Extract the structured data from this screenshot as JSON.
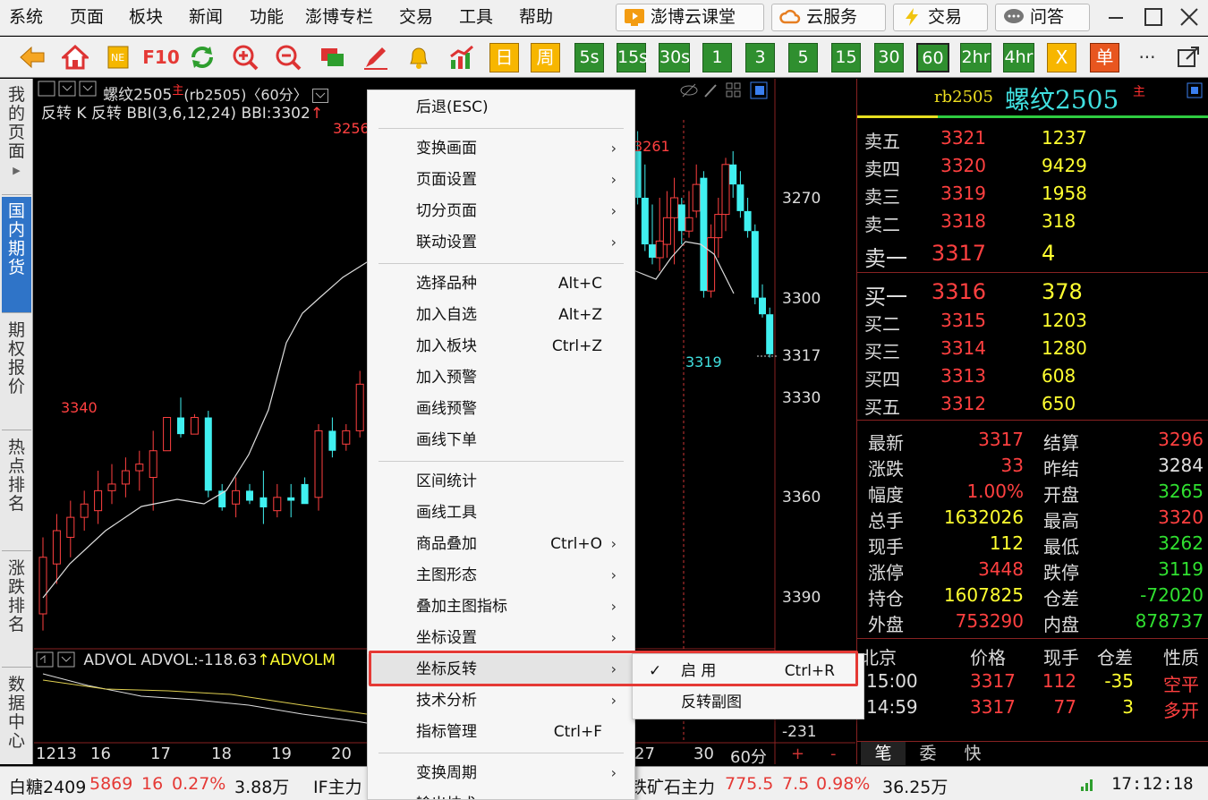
{
  "menubar": {
    "items": [
      "系统",
      "页面",
      "板块",
      "新闻",
      "功能",
      "澎博专栏",
      "交易",
      "工具",
      "帮助"
    ],
    "services": [
      "澎博云课堂",
      "云服务",
      "交易",
      "问答"
    ]
  },
  "toolbar": {
    "f10": "F10",
    "day": "日",
    "week": "周",
    "periods": [
      "5s",
      "15s",
      "30s",
      "1",
      "3",
      "5",
      "15",
      "30",
      "60",
      "2hr",
      "4hr"
    ],
    "x_label": "X",
    "dan_label": "单",
    "more": "···"
  },
  "sidetabs": [
    "我的页面",
    "国内期货",
    "期权报价",
    "热点排名",
    "涨跌排名",
    "数据中心"
  ],
  "chart": {
    "title_name": "螺纹2505",
    "title_main": "主",
    "title_code": "(rb2505)",
    "title_period": "〈60分〉",
    "indicator_line": "反转 K 反转 BBI(3,6,12,24) BBI:3302",
    "price_axis": [
      "3270",
      "3300",
      "3317",
      "3330",
      "3360",
      "3390"
    ],
    "annotations": {
      "low_left": "3340",
      "high_mid": "3256",
      "high_right": "3261",
      "last_low": "3319"
    },
    "sub_indicator": "ADVOL ADVOL:-118.63",
    "sub_indicator2": "ADVOLM",
    "sub_axis": "-231",
    "date_axis": [
      "1213",
      "16",
      "17",
      "18",
      "19",
      "20",
      "27",
      "30"
    ],
    "period_label": "60分",
    "plus": "+",
    "minus": "-"
  },
  "quote": {
    "code": "rb2505",
    "name": "螺纹2505",
    "main": "主",
    "asks": [
      {
        "l": "卖五",
        "p": "3321",
        "v": "1237"
      },
      {
        "l": "卖四",
        "p": "3320",
        "v": "9429"
      },
      {
        "l": "卖三",
        "p": "3319",
        "v": "1958"
      },
      {
        "l": "卖二",
        "p": "3318",
        "v": "318"
      },
      {
        "l": "卖一",
        "p": "3317",
        "v": "4"
      }
    ],
    "bids": [
      {
        "l": "买一",
        "p": "3316",
        "v": "378"
      },
      {
        "l": "买二",
        "p": "3315",
        "v": "1203"
      },
      {
        "l": "买三",
        "p": "3314",
        "v": "1280"
      },
      {
        "l": "买四",
        "p": "3313",
        "v": "608"
      },
      {
        "l": "买五",
        "p": "3312",
        "v": "650"
      }
    ],
    "stats": [
      {
        "l1": "最新",
        "v1": "3317",
        "c1": "#ff4040",
        "l2": "结算",
        "v2": "3296",
        "c2": "#ff4040"
      },
      {
        "l1": "涨跌",
        "v1": "33",
        "c1": "#ff4040",
        "l2": "昨结",
        "v2": "3284",
        "c2": "#e0e0e0"
      },
      {
        "l1": "幅度",
        "v1": "1.00%",
        "c1": "#ff4040",
        "l2": "开盘",
        "v2": "3265",
        "c2": "#30e030"
      },
      {
        "l1": "总手",
        "v1": "1632026",
        "c1": "#ffff30",
        "l2": "最高",
        "v2": "3320",
        "c2": "#ff4040"
      },
      {
        "l1": "现手",
        "v1": "112",
        "c1": "#ffff30",
        "l2": "最低",
        "v2": "3262",
        "c2": "#30e030"
      },
      {
        "l1": "涨停",
        "v1": "3448",
        "c1": "#ff4040",
        "l2": "跌停",
        "v2": "3119",
        "c2": "#30e030"
      },
      {
        "l1": "持仓",
        "v1": "1607825",
        "c1": "#ffff30",
        "l2": "仓差",
        "v2": "-72020",
        "c2": "#30e030"
      },
      {
        "l1": "外盘",
        "v1": "753290",
        "c1": "#ff4040",
        "l2": "内盘",
        "v2": "878737",
        "c2": "#30e030"
      }
    ],
    "ticks_header": [
      "北京",
      "价格",
      "现手",
      "仓差",
      "性质"
    ],
    "ticks": [
      [
        "15:00",
        "3317",
        "112",
        "-35",
        "空平"
      ],
      [
        "14:59",
        "3317",
        "77",
        "3",
        "多开"
      ]
    ],
    "tabs": [
      "笔",
      "委",
      "快"
    ]
  },
  "context_menu": {
    "items": [
      {
        "label": "后退(ESC)",
        "shortcut": "",
        "arrow": false
      },
      {
        "label": "变换画面",
        "shortcut": "",
        "arrow": true
      },
      {
        "label": "页面设置",
        "shortcut": "",
        "arrow": true
      },
      {
        "label": "切分页面",
        "shortcut": "",
        "arrow": true
      },
      {
        "label": "联动设置",
        "shortcut": "",
        "arrow": true
      },
      {
        "label": "选择品种",
        "shortcut": "Alt+C",
        "arrow": false
      },
      {
        "label": "加入自选",
        "shortcut": "Alt+Z",
        "arrow": false
      },
      {
        "label": "加入板块",
        "shortcut": "Ctrl+Z",
        "arrow": false
      },
      {
        "label": "加入预警",
        "shortcut": "",
        "arrow": false
      },
      {
        "label": "画线预警",
        "shortcut": "",
        "arrow": false
      },
      {
        "label": "画线下单",
        "shortcut": "",
        "arrow": false
      },
      {
        "label": "区间统计",
        "shortcut": "",
        "arrow": false
      },
      {
        "label": "画线工具",
        "shortcut": "",
        "arrow": false
      },
      {
        "label": "商品叠加",
        "shortcut": "Ctrl+O",
        "arrow": true
      },
      {
        "label": "主图形态",
        "shortcut": "",
        "arrow": true
      },
      {
        "label": "叠加主图指标",
        "shortcut": "",
        "arrow": true
      },
      {
        "label": "坐标设置",
        "shortcut": "",
        "arrow": true
      },
      {
        "label": "坐标反转",
        "shortcut": "",
        "arrow": true
      },
      {
        "label": "技术分析",
        "shortcut": "",
        "arrow": true
      },
      {
        "label": "指标管理",
        "shortcut": "Ctrl+F",
        "arrow": false
      },
      {
        "label": "变换周期",
        "shortcut": "",
        "arrow": true
      },
      {
        "label": "输出技术",
        "shortcut": "",
        "arrow": true
      }
    ],
    "submenu": [
      {
        "label": "启 用",
        "shortcut": "Ctrl+R",
        "checked": true
      },
      {
        "label": "反转副图",
        "shortcut": "",
        "checked": false
      }
    ]
  },
  "statusbar": {
    "s1": {
      "name": "白糖2409",
      "price": "5869",
      "chg": "16",
      "pct": "0.27%",
      "vol": "3.88万"
    },
    "s2": {
      "name": "IF主力"
    },
    "s3": {
      "name": "铁矿石主力",
      "price": "775.5",
      "chg": "7.5",
      "pct": "0.98%",
      "vol": "36.25万"
    },
    "time": "17:12:18"
  }
}
